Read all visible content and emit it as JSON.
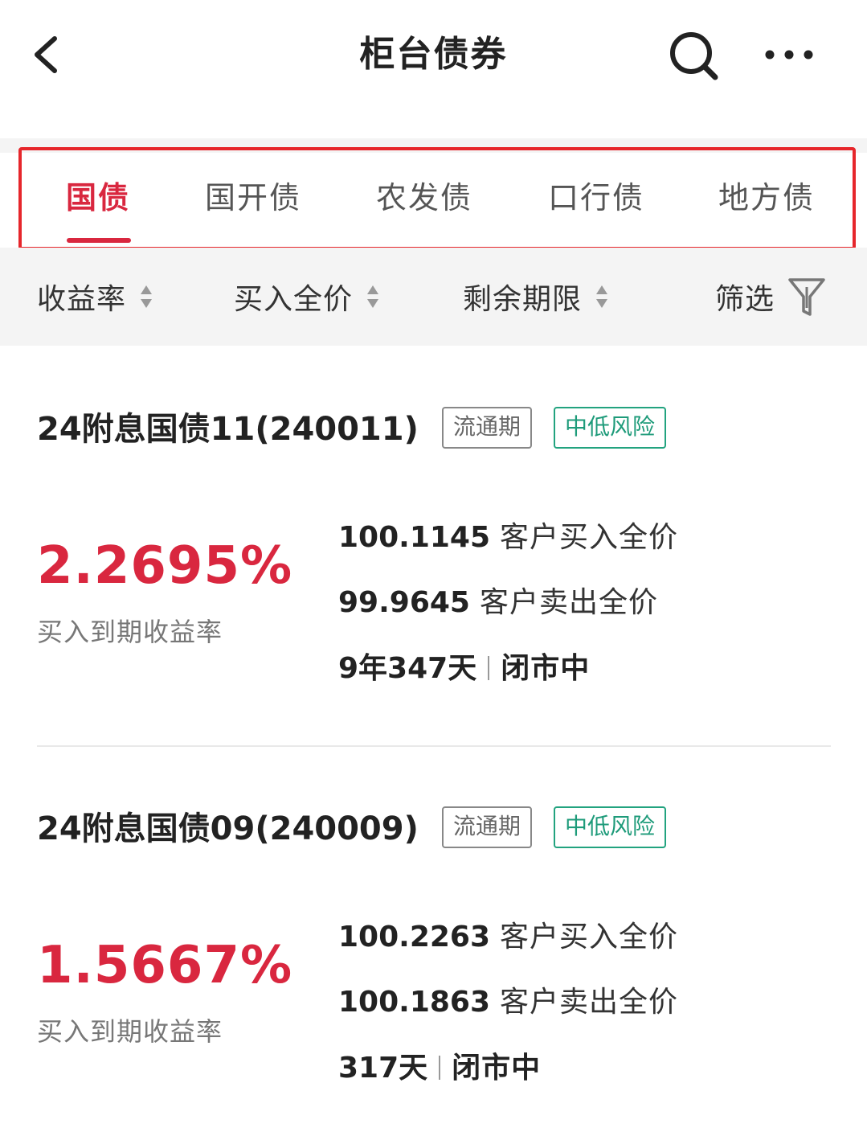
{
  "header": {
    "title": "柜台债券"
  },
  "tabs": [
    {
      "label": "国债",
      "active": true
    },
    {
      "label": "国开债",
      "active": false
    },
    {
      "label": "农发债",
      "active": false
    },
    {
      "label": "口行债",
      "active": false
    },
    {
      "label": "地方债",
      "active": false
    }
  ],
  "sortbar": {
    "yield": "收益率",
    "price": "买入全价",
    "term": "剩余期限",
    "filter": "筛选"
  },
  "bonds": [
    {
      "name": "24附息国债11(240011)",
      "tag_period": "流通期",
      "tag_risk": "中低风险",
      "yield": "2.2695%",
      "yield_label": "买入到期收益率",
      "buy_price": "100.1145",
      "buy_label": "客户买入全价",
      "sell_price": "99.9645",
      "sell_label": "客户卖出全价",
      "term": "9年347天",
      "status": "闭市中"
    },
    {
      "name": "24附息国债09(240009)",
      "tag_period": "流通期",
      "tag_risk": "中低风险",
      "yield": "1.5667%",
      "yield_label": "买入到期收益率",
      "buy_price": "100.2263",
      "buy_label": "客户买入全价",
      "sell_price": "100.1863",
      "sell_label": "客户卖出全价",
      "term": "317天",
      "status": "闭市中"
    }
  ],
  "colors": {
    "accent": "#d9273f",
    "risk_green": "#1e9b7a",
    "highlight_border": "#e6262b",
    "band_gray": "#f4f4f4"
  }
}
